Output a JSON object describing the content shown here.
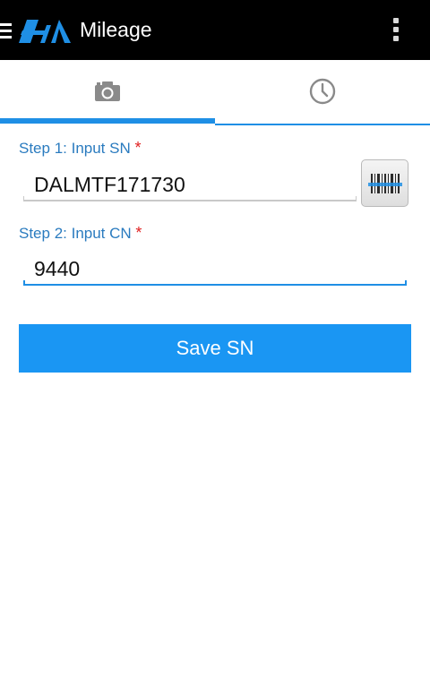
{
  "appbar": {
    "title": "Mileage",
    "icons": [
      "menu-icon",
      "logo",
      "overflow-menu-icon"
    ]
  },
  "tabs": [
    {
      "icon": "camera-icon",
      "active": true
    },
    {
      "icon": "clock-icon",
      "active": false
    }
  ],
  "form": {
    "sn_label": "Step 1: Input SN",
    "cn_label": "Step 2: Input CN",
    "required_mark": "*",
    "sn_value": "DALMTF171730",
    "cn_value": "9440",
    "scan_icon": "barcode-scan-icon"
  },
  "actions": {
    "save_label": "Save SN"
  },
  "colors": {
    "appbar": "#000000",
    "accent": "#1f8fe5",
    "button": "#1a96f3",
    "label": "#2a7bbf",
    "required": "#e02020"
  }
}
